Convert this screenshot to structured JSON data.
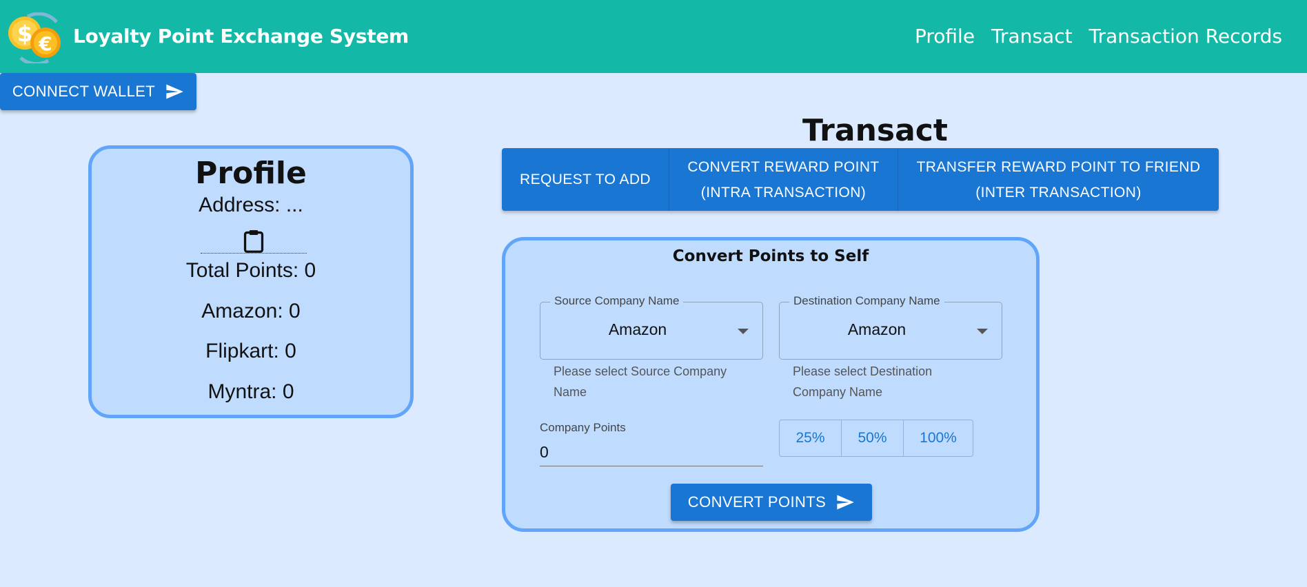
{
  "header": {
    "title": "Loyalty Point Exchange System",
    "logo_icon": "currency-coins-icon",
    "nav": [
      "Profile",
      "Transact",
      "Transaction Records"
    ]
  },
  "wallet": {
    "connect_label": "CONNECT WALLET"
  },
  "profile": {
    "title": "Profile",
    "address": "Address: ...",
    "total_points": "Total Points: 0",
    "companies": [
      "Amazon: 0",
      "Flipkart: 0",
      "Myntra: 0"
    ]
  },
  "transact": {
    "title": "Transact",
    "tabs": [
      {
        "line1": "REQUEST TO ADD",
        "line2": ""
      },
      {
        "line1": "CONVERT REWARD POINT",
        "line2": "(INTRA TRANSACTION)"
      },
      {
        "line1": "TRANSFER REWARD POINT TO FRIEND",
        "line2": "(INTER TRANSACTION)"
      }
    ]
  },
  "convert": {
    "title": "Convert Points to Self",
    "source": {
      "label": "Source Company Name",
      "value": "Amazon",
      "helper_line1": "Please select Source Company",
      "helper_line2": "Name"
    },
    "destination": {
      "label": "Destination Company Name",
      "value": "Amazon",
      "helper_line1": "Please select Destination",
      "helper_line2": "Company Name"
    },
    "points": {
      "label": "Company Points",
      "value": "0"
    },
    "percent_buttons": [
      "25%",
      "50%",
      "100%"
    ],
    "submit_label": "CONVERT POINTS"
  },
  "colors": {
    "header_bg": "#14b8a6",
    "page_bg": "#dbeafe",
    "card_bg": "#bfdbfe",
    "card_border": "#60a5fa",
    "primary": "#1976d2"
  }
}
